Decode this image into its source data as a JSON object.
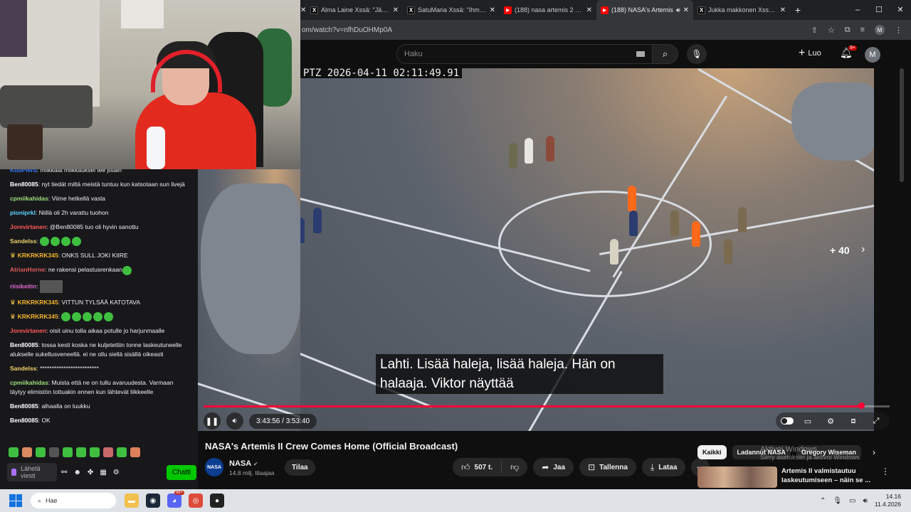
{
  "browser": {
    "tabs": [
      {
        "title": "Alma Laine Xssä: \"Jättimä",
        "favicon": "x-icon"
      },
      {
        "title": "SatuMaria Xssä: \"Ihmiset",
        "favicon": "x-icon"
      },
      {
        "title": "(188) nasa artemis 2 - Yo",
        "favicon": "youtube-icon"
      },
      {
        "title": "(188) NASA's Artemis",
        "favicon": "youtube-icon",
        "active": true,
        "audio": true
      },
      {
        "title": "Jukka makkonen Xssä: \"I",
        "favicon": "x-icon"
      }
    ],
    "new_tab": "+",
    "window_controls": [
      "–",
      "☐",
      "✕"
    ],
    "url": "om/watch?v=nfhDuOHMp0A",
    "profile_initial": "M"
  },
  "youtube": {
    "search_placeholder": "Haku",
    "create_label": "Luo",
    "notifications_badge": "9+",
    "avatar_initial": "M"
  },
  "chat": {
    "messages": [
      {
        "user": "KuuPieru",
        "text": "miikkaat miikkauksel tee jotain",
        "color": "#3a7bff"
      },
      {
        "user": "Ben80085",
        "text": "nyt tiedät miltä meistä tuntuu kun katsotaan sun livejä",
        "color": "#ffffff"
      },
      {
        "user": "cpmiikahidas",
        "text": "Viime hetkellä vasta",
        "color": "#9ee07a"
      },
      {
        "user": "pioniprkl",
        "text": "Niillä oli 2h varattu tuohon",
        "color": "#5fd3ff"
      },
      {
        "user": "Jorevirtanen",
        "text": "@Ben80085 tuo oli hyvin sanottu",
        "color": "#ff5a5a"
      },
      {
        "user": "Sandelss",
        "text": "",
        "color": "#f2d36a",
        "emotes": 4
      },
      {
        "user": "KRKRKRK345",
        "text": "ONKS SULL JOKI KIIRE",
        "color": "#f2b52a",
        "crown": true
      },
      {
        "user": "AtrianHorne",
        "text": "ne rakensi pelastusrenkaan",
        "color": "#e05a5a",
        "emotes_after": 1
      },
      {
        "user": "riisikeitin",
        "text": "",
        "color": "#e06bd4",
        "image": true
      },
      {
        "user": "KRKRKRK345",
        "text": "VITTUN TYLSÄÄ KATOTAVA",
        "color": "#f2b52a",
        "crown": true
      },
      {
        "user": "KRKRKRK345",
        "text": "",
        "color": "#f2b52a",
        "crown": true,
        "emotes": 5
      },
      {
        "user": "Jorevirtanen",
        "text": "oisit uinu tolla aikaa potulle jo harjunmaalle",
        "color": "#ff5a5a"
      },
      {
        "user": "Ben80085",
        "text": "tossa kesti koska ne kuljetettiin tonne laskeutuneelle alukselle sukellusveneellä. ei ne ollu siellä sisällä oikeasti",
        "color": "#ffffff"
      },
      {
        "user": "Sandelss",
        "text": "*************************",
        "color": "#f2d36a"
      },
      {
        "user": "cpmiikahidas",
        "text": "Muista että ne on tullu avaruudesta. Varmaan täytyy elimistön tottuakin ennen kun lähtevät liikkeelle",
        "color": "#9ee07a"
      },
      {
        "user": "Ben80085",
        "text": "alhaalla on luukku",
        "color": "#ffffff"
      },
      {
        "user": "Ben80085",
        "text": "OK",
        "color": "#ffffff"
      }
    ],
    "input_placeholder": "Lähetä viesti",
    "send_label": "Chatti"
  },
  "video": {
    "timestamp_overlay": "PTZ 2026-04-11 02:11:49.91",
    "subtitle": "Lahti. Lisää haleja, lisää haleja. Hän on halaaja. Viktor näyttää",
    "more_count": "+ 40",
    "time_current": "3:43:56",
    "time_total": "3:53:40",
    "progress": 0.958,
    "title": "NASA's Artemis II Crew Comes Home (Official Broadcast)",
    "channel": "NASA",
    "subscribers": "14,8 milj. tilaajaa",
    "subscribe_label": "Tilaa",
    "likes": "507 t.",
    "share_label": "Jaa",
    "save_label": "Tallenna",
    "download_label": "Lataa"
  },
  "sidebar": {
    "chips": [
      {
        "label": "Kaikki",
        "active": true
      },
      {
        "label": "Ladannut NASA"
      },
      {
        "label": "Gregory Wiseman"
      }
    ],
    "recommendation_title": "Artemis II valmistautuu laskeutumiseen – näin se ..."
  },
  "windows_watermark": {
    "line1": "Aktivoi Windows",
    "line2": "Siirry asetuksiin ja aktivoi Windows."
  },
  "taskbar": {
    "search_label": "Hae",
    "time": "14.16",
    "date": "11.4.2026",
    "badge": "99+"
  },
  "colors": {
    "progress": "#ff0033",
    "chat_send": "#00c800",
    "taskbar": "#dfe3e8"
  }
}
